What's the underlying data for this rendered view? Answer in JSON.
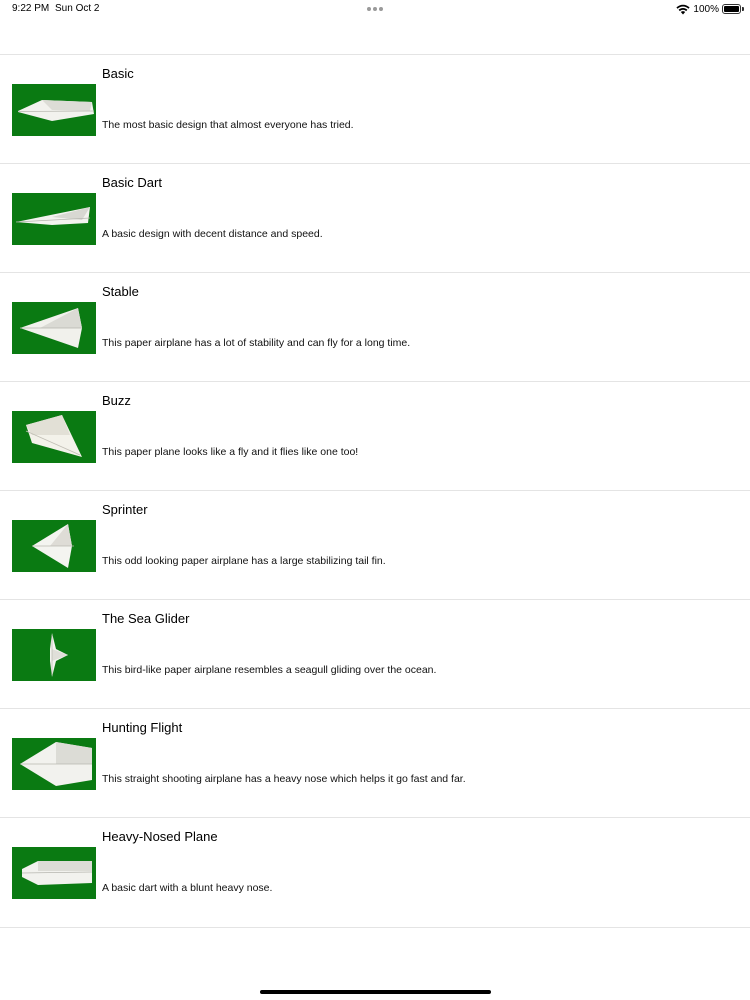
{
  "status_bar": {
    "time": "9:22 PM",
    "date": "Sun Oct 2",
    "battery_percent": "100%",
    "battery_level": 1.0
  },
  "planes": [
    {
      "title": "Basic",
      "description": "The most basic design that almost everyone has tried.",
      "icon": "paper-plane-basic"
    },
    {
      "title": "Basic Dart",
      "description": "A basic design with decent distance and speed.",
      "icon": "paper-plane-dart"
    },
    {
      "title": "Stable",
      "description": "This paper airplane has a lot of stability and can fly for a long time.",
      "icon": "paper-plane-stable"
    },
    {
      "title": "Buzz",
      "description": "This paper plane looks like a fly and it flies like one too!",
      "icon": "paper-plane-buzz"
    },
    {
      "title": "Sprinter",
      "description": "This odd looking paper airplane has a large stabilizing tail fin.",
      "icon": "paper-plane-sprinter"
    },
    {
      "title": "The Sea Glider",
      "description": "This bird-like paper airplane resembles a seagull gliding over the ocean.",
      "icon": "paper-plane-sea-glider"
    },
    {
      "title": "Hunting Flight",
      "description": "This straight shooting airplane has a heavy nose which helps it go fast and far.",
      "icon": "paper-plane-hunting"
    },
    {
      "title": "Heavy-Nosed Plane",
      "description": "A basic dart with a blunt heavy nose.",
      "icon": "paper-plane-heavy-nose"
    }
  ],
  "colors": {
    "thumbnail_background": "#0a7a12",
    "separator": "#e4e4e4"
  }
}
